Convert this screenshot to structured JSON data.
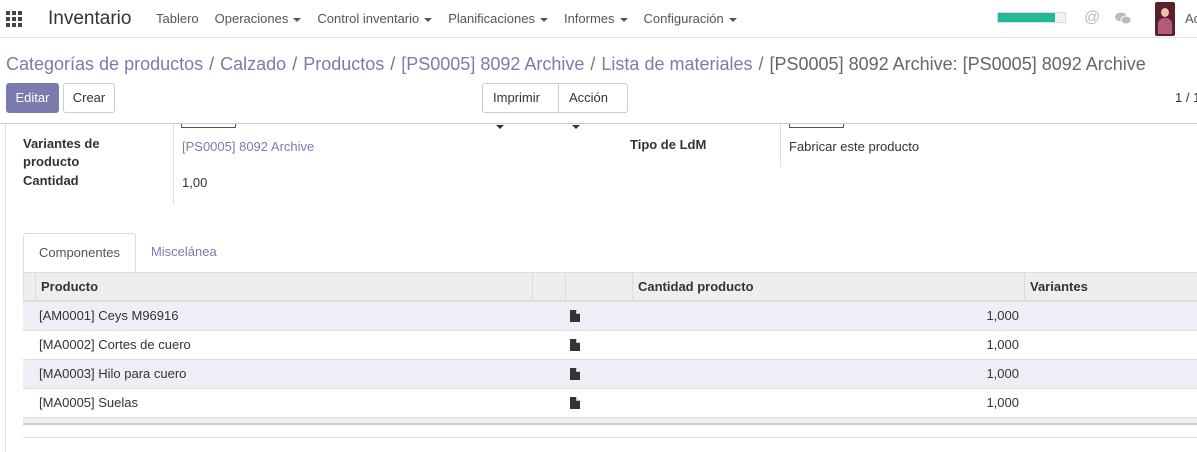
{
  "navbar": {
    "brand": "Inventario",
    "menu": [
      {
        "label": "Tablero",
        "has_caret": false
      },
      {
        "label": "Operaciones",
        "has_caret": true
      },
      {
        "label": "Control inventario",
        "has_caret": true
      },
      {
        "label": "Planificaciones",
        "has_caret": true
      },
      {
        "label": "Informes",
        "has_caret": true
      },
      {
        "label": "Configuración",
        "has_caret": true
      }
    ],
    "progress_fraction": 0.85,
    "progress_color": "#21b799",
    "at_symbol": "@",
    "user_initials": "Ac"
  },
  "breadcrumb": {
    "links": [
      "Categorías de productos",
      "Calzado",
      "Productos",
      "[PS0005] 8092 Archive",
      "Lista de materiales"
    ],
    "separator": "/",
    "current": "[PS0005] 8092 Archive: [PS0005] 8092 Archive"
  },
  "buttons": {
    "edit": "Editar",
    "create": "Crear",
    "print": "Imprimir",
    "action": "Acción"
  },
  "pager": "1 / 1",
  "form": {
    "variants_label": "Variantes de producto",
    "variants_value": "[PS0005] 8092 Archive",
    "quantity_label": "Cantidad",
    "quantity_value": "1,00",
    "bom_type_label": "Tipo de LdM",
    "bom_type_value": "Fabricar este producto"
  },
  "tabs": [
    "Componentes",
    "Miscelánea"
  ],
  "table": {
    "headers": [
      "Producto",
      "Cantidad producto",
      "Variantes"
    ],
    "rows": [
      {
        "product": "[AM0001] Ceys M96916",
        "quantity": "1,000"
      },
      {
        "product": "[MA0002] Cortes de cuero",
        "quantity": "1,000"
      },
      {
        "product": "[MA0003] Hilo para cuero",
        "quantity": "1,000"
      },
      {
        "product": "[MA0005] Suelas",
        "quantity": "1,000"
      }
    ]
  },
  "colors": {
    "primary": "#7c7bad",
    "odd_row": "#eeeef6"
  }
}
